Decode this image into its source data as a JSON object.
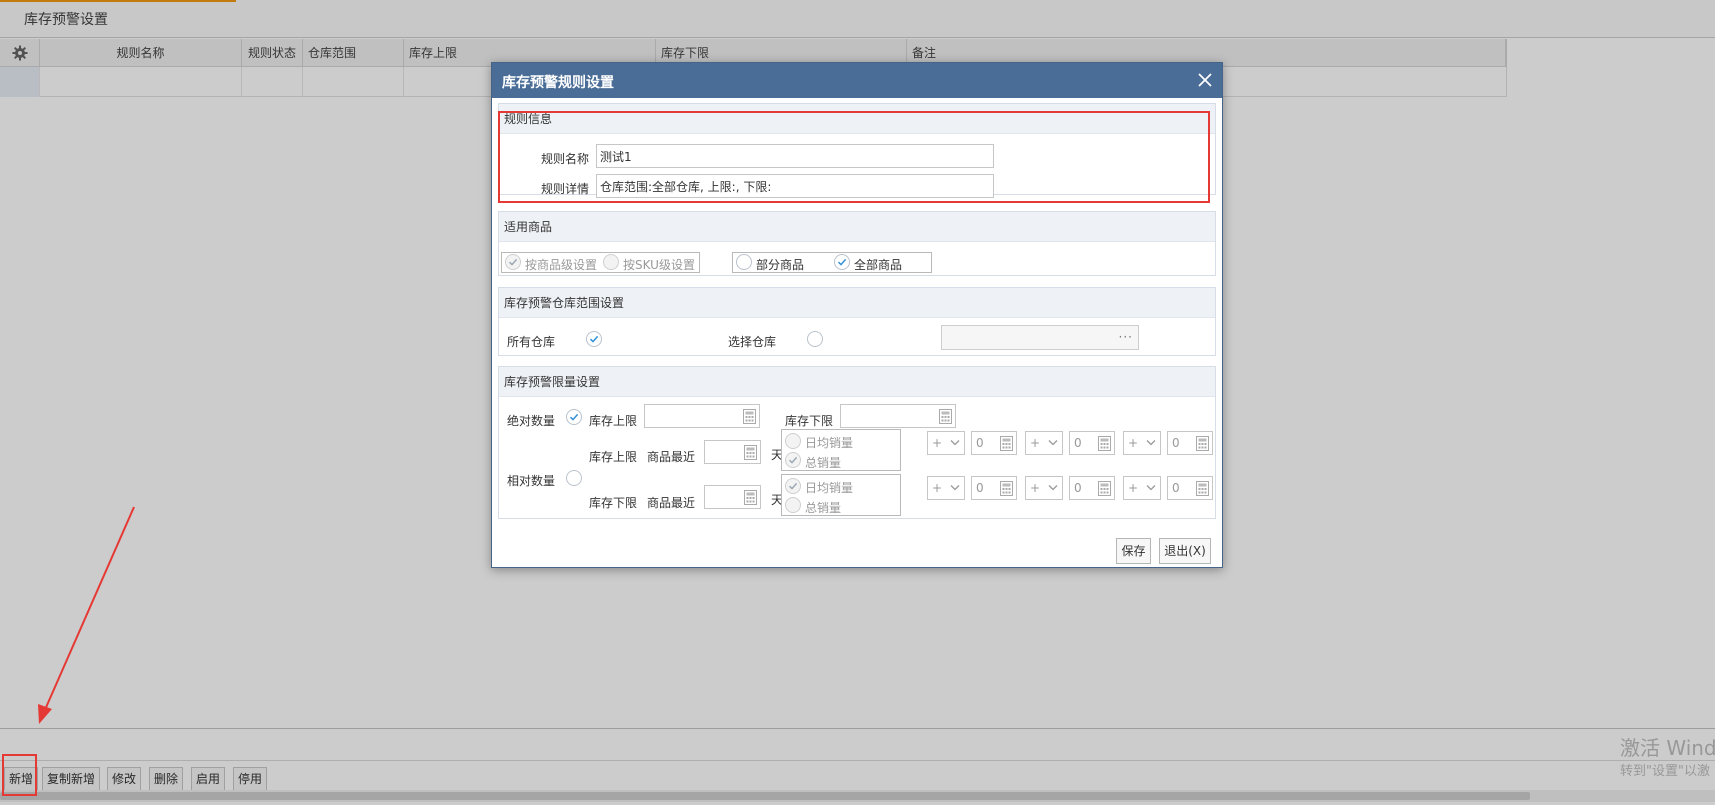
{
  "page": {
    "title": "库存预警设置"
  },
  "grid": {
    "columns": [
      "规则名称",
      "规则状态",
      "仓库范围",
      "库存上限",
      "库存下限",
      "备注"
    ]
  },
  "toolbar": {
    "buttons": [
      "新增",
      "复制新增",
      "修改",
      "删除",
      "启用",
      "停用"
    ]
  },
  "watermark": {
    "line1": "激活 Wind",
    "line2": "转到\"设置\"以激"
  },
  "dialog": {
    "title": "库存预警规则设置",
    "rule_info": {
      "head": "规则信息",
      "name_label": "规则名称",
      "name_value": "测试1",
      "detail_label": "规则详情",
      "detail_value": "仓库范围:全部仓库, 上限:, 下限:"
    },
    "goods": {
      "head": "适用商品",
      "level_options": [
        {
          "label": "按商品级设置",
          "checked": true
        },
        {
          "label": "按SKU级设置",
          "checked": false
        }
      ],
      "scope_options": [
        {
          "label": "部分商品",
          "checked": false
        },
        {
          "label": "全部商品",
          "checked": true
        }
      ]
    },
    "warehouse": {
      "head": "库存预警仓库范围设置",
      "all_label": "所有仓库",
      "all_checked": true,
      "select_label": "选择仓库",
      "select_checked": false,
      "picker_dots": "···"
    },
    "limits": {
      "head": "库存预警限量设置",
      "absolute": {
        "label": "绝对数量",
        "checked": true,
        "upper_label": "库存上限",
        "lower_label": "库存下限"
      },
      "relative": {
        "label": "相对数量",
        "checked": false,
        "rows": [
          {
            "limit_label": "库存上限",
            "recent_label": "商品最近",
            "day_label": "天",
            "opt_daily": "日均销量",
            "opt_total": "总销量",
            "selected": "total",
            "terms": [
              {
                "sign": "+",
                "value": "0"
              },
              {
                "sign": "+",
                "value": "0"
              },
              {
                "sign": "+",
                "value": "0"
              }
            ]
          },
          {
            "limit_label": "库存下限",
            "recent_label": "商品最近",
            "day_label": "天",
            "opt_daily": "日均销量",
            "opt_total": "总销量",
            "selected": "daily",
            "terms": [
              {
                "sign": "+",
                "value": "0"
              },
              {
                "sign": "+",
                "value": "0"
              },
              {
                "sign": "+",
                "value": "0"
              }
            ]
          }
        ]
      }
    },
    "footer": {
      "save_label": "保存",
      "exit_label": "退出(X)"
    }
  },
  "colors": {
    "dialog_header": "#4a6d97",
    "highlight_red": "#e53935",
    "check_blue": "#2f8fd8",
    "accent_orange": "#f39c12"
  },
  "icons": [
    "gear-icon",
    "close-icon",
    "check-icon",
    "calculator-icon",
    "chevron-down-icon",
    "arrow-annotation"
  ]
}
